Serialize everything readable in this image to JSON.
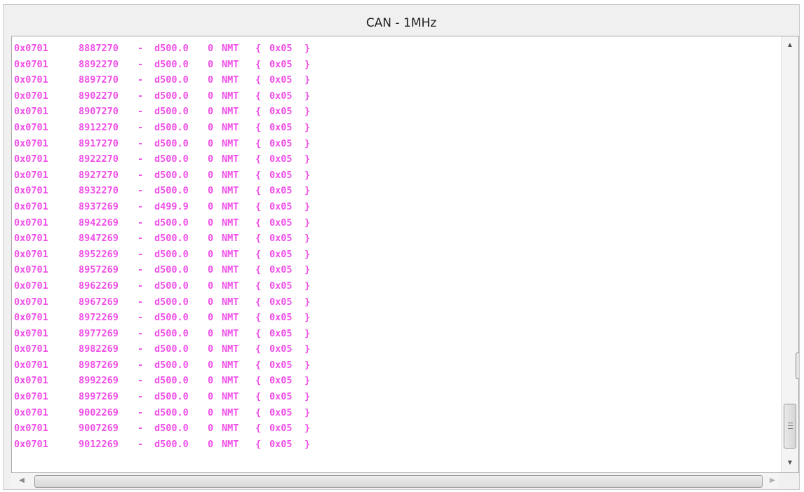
{
  "window": {
    "title": "CAN - 1MHz"
  },
  "log": {
    "text_color": "#f04fe8",
    "lines": [
      {
        "id": "0x0701",
        "timestamp": "8887270",
        "sep": "-",
        "delta": "d500.0",
        "flag": "0",
        "type": "NMT",
        "open": "{",
        "data": "0x05",
        "close": "}"
      },
      {
        "id": "0x0701",
        "timestamp": "8892270",
        "sep": "-",
        "delta": "d500.0",
        "flag": "0",
        "type": "NMT",
        "open": "{",
        "data": "0x05",
        "close": "}"
      },
      {
        "id": "0x0701",
        "timestamp": "8897270",
        "sep": "-",
        "delta": "d500.0",
        "flag": "0",
        "type": "NMT",
        "open": "{",
        "data": "0x05",
        "close": "}"
      },
      {
        "id": "0x0701",
        "timestamp": "8902270",
        "sep": "-",
        "delta": "d500.0",
        "flag": "0",
        "type": "NMT",
        "open": "{",
        "data": "0x05",
        "close": "}"
      },
      {
        "id": "0x0701",
        "timestamp": "8907270",
        "sep": "-",
        "delta": "d500.0",
        "flag": "0",
        "type": "NMT",
        "open": "{",
        "data": "0x05",
        "close": "}"
      },
      {
        "id": "0x0701",
        "timestamp": "8912270",
        "sep": "-",
        "delta": "d500.0",
        "flag": "0",
        "type": "NMT",
        "open": "{",
        "data": "0x05",
        "close": "}"
      },
      {
        "id": "0x0701",
        "timestamp": "8917270",
        "sep": "-",
        "delta": "d500.0",
        "flag": "0",
        "type": "NMT",
        "open": "{",
        "data": "0x05",
        "close": "}"
      },
      {
        "id": "0x0701",
        "timestamp": "8922270",
        "sep": "-",
        "delta": "d500.0",
        "flag": "0",
        "type": "NMT",
        "open": "{",
        "data": "0x05",
        "close": "}"
      },
      {
        "id": "0x0701",
        "timestamp": "8927270",
        "sep": "-",
        "delta": "d500.0",
        "flag": "0",
        "type": "NMT",
        "open": "{",
        "data": "0x05",
        "close": "}"
      },
      {
        "id": "0x0701",
        "timestamp": "8932270",
        "sep": "-",
        "delta": "d500.0",
        "flag": "0",
        "type": "NMT",
        "open": "{",
        "data": "0x05",
        "close": "}"
      },
      {
        "id": "0x0701",
        "timestamp": "8937269",
        "sep": "-",
        "delta": "d499.9",
        "flag": "0",
        "type": "NMT",
        "open": "{",
        "data": "0x05",
        "close": "}"
      },
      {
        "id": "0x0701",
        "timestamp": "8942269",
        "sep": "-",
        "delta": "d500.0",
        "flag": "0",
        "type": "NMT",
        "open": "{",
        "data": "0x05",
        "close": "}"
      },
      {
        "id": "0x0701",
        "timestamp": "8947269",
        "sep": "-",
        "delta": "d500.0",
        "flag": "0",
        "type": "NMT",
        "open": "{",
        "data": "0x05",
        "close": "}"
      },
      {
        "id": "0x0701",
        "timestamp": "8952269",
        "sep": "-",
        "delta": "d500.0",
        "flag": "0",
        "type": "NMT",
        "open": "{",
        "data": "0x05",
        "close": "}"
      },
      {
        "id": "0x0701",
        "timestamp": "8957269",
        "sep": "-",
        "delta": "d500.0",
        "flag": "0",
        "type": "NMT",
        "open": "{",
        "data": "0x05",
        "close": "}"
      },
      {
        "id": "0x0701",
        "timestamp": "8962269",
        "sep": "-",
        "delta": "d500.0",
        "flag": "0",
        "type": "NMT",
        "open": "{",
        "data": "0x05",
        "close": "}"
      },
      {
        "id": "0x0701",
        "timestamp": "8967269",
        "sep": "-",
        "delta": "d500.0",
        "flag": "0",
        "type": "NMT",
        "open": "{",
        "data": "0x05",
        "close": "}"
      },
      {
        "id": "0x0701",
        "timestamp": "8972269",
        "sep": "-",
        "delta": "d500.0",
        "flag": "0",
        "type": "NMT",
        "open": "{",
        "data": "0x05",
        "close": "}"
      },
      {
        "id": "0x0701",
        "timestamp": "8977269",
        "sep": "-",
        "delta": "d500.0",
        "flag": "0",
        "type": "NMT",
        "open": "{",
        "data": "0x05",
        "close": "}"
      },
      {
        "id": "0x0701",
        "timestamp": "8982269",
        "sep": "-",
        "delta": "d500.0",
        "flag": "0",
        "type": "NMT",
        "open": "{",
        "data": "0x05",
        "close": "}"
      },
      {
        "id": "0x0701",
        "timestamp": "8987269",
        "sep": "-",
        "delta": "d500.0",
        "flag": "0",
        "type": "NMT",
        "open": "{",
        "data": "0x05",
        "close": "}"
      },
      {
        "id": "0x0701",
        "timestamp": "8992269",
        "sep": "-",
        "delta": "d500.0",
        "flag": "0",
        "type": "NMT",
        "open": "{",
        "data": "0x05",
        "close": "}"
      },
      {
        "id": "0x0701",
        "timestamp": "8997269",
        "sep": "-",
        "delta": "d500.0",
        "flag": "0",
        "type": "NMT",
        "open": "{",
        "data": "0x05",
        "close": "}"
      },
      {
        "id": "0x0701",
        "timestamp": "9002269",
        "sep": "-",
        "delta": "d500.0",
        "flag": "0",
        "type": "NMT",
        "open": "{",
        "data": "0x05",
        "close": "}"
      },
      {
        "id": "0x0701",
        "timestamp": "9007269",
        "sep": "-",
        "delta": "d500.0",
        "flag": "0",
        "type": "NMT",
        "open": "{",
        "data": "0x05",
        "close": "}"
      },
      {
        "id": "0x0701",
        "timestamp": "9012269",
        "sep": "-",
        "delta": "d500.0",
        "flag": "0",
        "type": "NMT",
        "open": "{",
        "data": "0x05",
        "close": "}"
      }
    ]
  },
  "scrollbars": {
    "vertical": {
      "up_icon": "triangle-up",
      "down_icon": "triangle-down",
      "grip_icon": "grip-lines"
    },
    "horizontal": {
      "left_icon": "triangle-left",
      "right_icon": "triangle-right"
    }
  }
}
